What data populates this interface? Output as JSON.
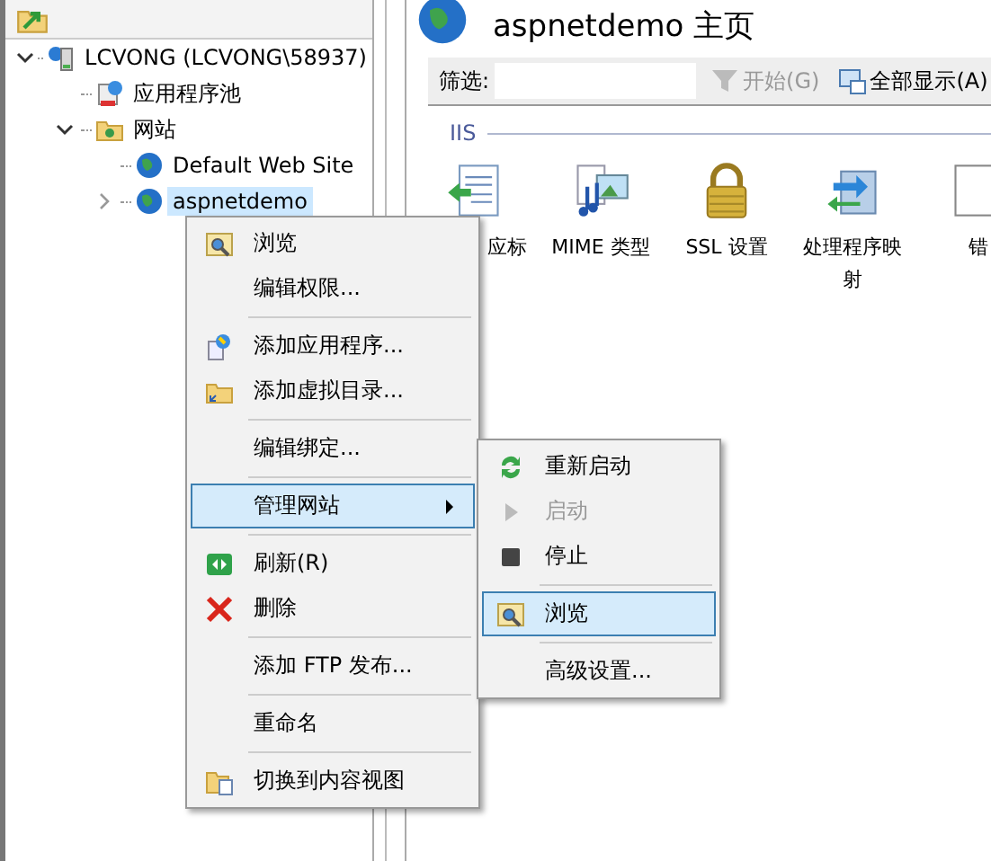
{
  "tree": [
    {
      "label": "LCVONG (LCVONG\\58937)",
      "kind": "server",
      "expanded": true,
      "selected": false,
      "children": [
        {
          "label": "应用程序池",
          "kind": "pool",
          "selected": false
        },
        {
          "label": "网站",
          "kind": "folder",
          "expanded": true,
          "selected": false,
          "children": [
            {
              "label": "Default Web Site",
              "kind": "site",
              "selected": false
            },
            {
              "label": "aspnetdemo",
              "kind": "site",
              "expanded": false,
              "selected": true
            }
          ]
        }
      ]
    }
  ],
  "page": {
    "title": "aspnetdemo 主页"
  },
  "filter": {
    "label": "筛选:",
    "go": {
      "label": "开始(G)",
      "disabled": true
    },
    "show_all": {
      "label": "全部显示(A)",
      "disabled": false
    }
  },
  "group": {
    "title": "IIS",
    "features": [
      {
        "label": "应标",
        "kind": "headers"
      },
      {
        "label": "MIME 类型",
        "kind": "mime"
      },
      {
        "label": "SSL 设置",
        "kind": "lock"
      },
      {
        "label": "处理程序映射",
        "kind": "handler"
      },
      {
        "label": "错",
        "kind": "page"
      }
    ]
  },
  "context_menu": {
    "groups": [
      [
        {
          "label": "浏览",
          "kind": "browse",
          "selected": false
        },
        {
          "label": "编辑权限...",
          "kind": "none",
          "selected": false
        }
      ],
      [
        {
          "label": "添加应用程序...",
          "kind": "app",
          "selected": false
        },
        {
          "label": "添加虚拟目录...",
          "kind": "vdir",
          "selected": false
        }
      ],
      [
        {
          "label": "编辑绑定...",
          "kind": "none",
          "selected": false
        }
      ],
      [
        {
          "label": "管理网站",
          "kind": "none",
          "selected": true,
          "submenu": true
        }
      ],
      [
        {
          "label": "刷新(R)",
          "kind": "refresh",
          "selected": false
        },
        {
          "label": "删除",
          "kind": "delete",
          "selected": false
        }
      ],
      [
        {
          "label": "添加 FTP 发布...",
          "kind": "none",
          "selected": false
        }
      ],
      [
        {
          "label": "重命名",
          "kind": "none",
          "selected": false
        }
      ],
      [
        {
          "label": "切换到内容视图",
          "kind": "content",
          "selected": false
        }
      ]
    ]
  },
  "submenu": {
    "groups": [
      [
        {
          "label": "重新启动",
          "kind": "restart",
          "selected": false,
          "disabled": false
        },
        {
          "label": "启动",
          "kind": "start",
          "selected": false,
          "disabled": true
        },
        {
          "label": "停止",
          "kind": "stop",
          "selected": false,
          "disabled": false
        }
      ],
      [
        {
          "label": "浏览",
          "kind": "browse",
          "selected": true,
          "disabled": false
        }
      ],
      [
        {
          "label": "高级设置...",
          "kind": "none",
          "selected": false,
          "disabled": false
        }
      ]
    ]
  }
}
